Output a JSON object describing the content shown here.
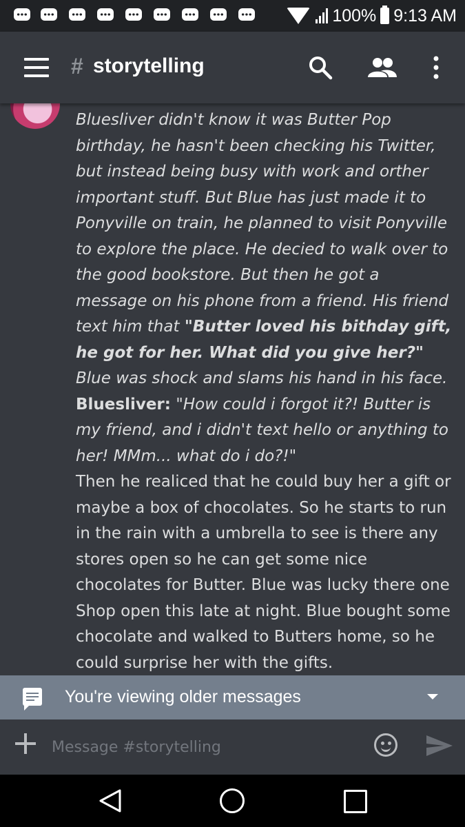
{
  "status_bar": {
    "notification_icons": [
      "discord-icon",
      "discord-icon",
      "discord-icon",
      "discord-icon",
      "discord-icon",
      "discord-icon",
      "discord-icon",
      "discord-icon",
      "discord-icon"
    ],
    "battery": "100%",
    "time": "9:13 AM"
  },
  "header": {
    "hash": "#",
    "channel": "storytelling"
  },
  "message": {
    "paragraph1": "Bluesliver didn't know it was Butter Pop birthday, he hasn't been checking his Twitter, but instead being busy with work and orther important stuff. But Blue has just made it to Ponyville on train, he planned to visit Ponyville to explore the place. He decied to walk over to the good bookstore. But then he got a message on his phone from a friend. His friend text him that ",
    "quote_bold": "\"Butter loved his bithday gift, he got for her. What did you give her?\"",
    "paragraph1_end": " Blue was shock and slams his hand in his face.",
    "speaker": "Bluesliver:",
    "speech": " \"How could i forgot it?! Butter is my friend, and i didn't text hello or anything to her! MMm... what do i do?!\"",
    "paragraph2": "Then he realiced that he could buy her a gift or maybe a box of chocolates. So he starts to run in the rain with a umbrella to see is there any stores open so he can get some nice chocolates for Butter. Blue was lucky there one Shop open this late at night. Blue bought some chocolate and walked to Butters home, so he could surprise her with the gifts."
  },
  "older_bar": {
    "label": "You're viewing older messages"
  },
  "composer": {
    "placeholder": "Message #storytelling"
  },
  "colors": {
    "background": "#36393f",
    "status_bar": "#202225",
    "older_bar": "#747f8d"
  }
}
